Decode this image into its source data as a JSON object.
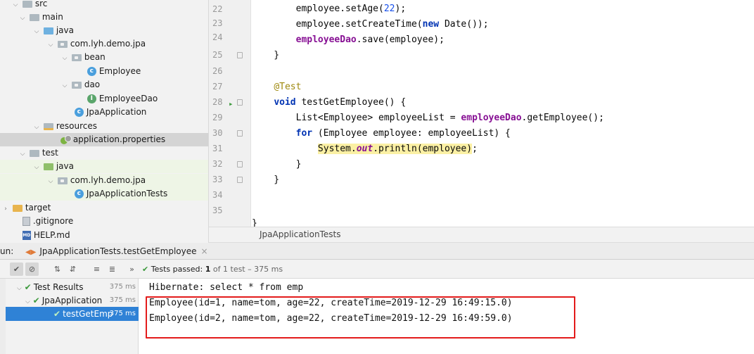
{
  "project_tree": [
    {
      "label": "src",
      "icon": "folder-icon",
      "arrow": "v",
      "indent": 1
    },
    {
      "label": "main",
      "icon": "folder-icon",
      "arrow": "v",
      "indent": 2
    },
    {
      "label": "java",
      "icon": "source-folder-icon",
      "arrow": "v",
      "indent": 3
    },
    {
      "label": "com.lyh.demo.jpa",
      "icon": "package-icon",
      "arrow": "v",
      "indent": 4
    },
    {
      "label": "bean",
      "icon": "package-icon",
      "arrow": "v",
      "indent": 5
    },
    {
      "label": "Employee",
      "icon": "class-icon",
      "arrow": "",
      "indent": 6
    },
    {
      "label": "dao",
      "icon": "package-icon",
      "arrow": "v",
      "indent": 5
    },
    {
      "label": "EmployeeDao",
      "icon": "interface-icon",
      "arrow": "",
      "indent": 6
    },
    {
      "label": "JpaApplication",
      "icon": "spring-class-icon",
      "arrow": "",
      "indent": 5
    },
    {
      "label": "resources",
      "icon": "resources-folder-icon",
      "arrow": "v",
      "indent": 3
    },
    {
      "label": "application.properties",
      "icon": "properties-file-icon",
      "arrow": "",
      "indent": 4
    },
    {
      "label": "test",
      "icon": "folder-icon",
      "arrow": "v",
      "indent": 2
    },
    {
      "label": "java",
      "icon": "test-folder-icon",
      "arrow": "v",
      "indent": 3
    },
    {
      "label": "com.lyh.demo.jpa",
      "icon": "package-icon",
      "arrow": "v",
      "indent": 4
    },
    {
      "label": "JpaApplicationTests",
      "icon": "spring-class-icon",
      "arrow": "",
      "indent": 5
    },
    {
      "label": "target",
      "icon": "excluded-folder-icon",
      "arrow": ">",
      "indent": 1
    },
    {
      "label": ".gitignore",
      "icon": "gitignore-file-icon",
      "arrow": "",
      "indent": 1
    },
    {
      "label": "HELP.md",
      "icon": "markdown-file-icon",
      "arrow": "",
      "indent": 1
    }
  ],
  "gutter": [
    {
      "num": "22"
    },
    {
      "num": "23"
    },
    {
      "num": "24"
    },
    {
      "num": "25"
    },
    {
      "num": "26"
    },
    {
      "num": "27"
    },
    {
      "num": "28"
    },
    {
      "num": "29"
    },
    {
      "num": "30"
    },
    {
      "num": "31"
    },
    {
      "num": "32"
    },
    {
      "num": "33"
    },
    {
      "num": "34"
    },
    {
      "num": "35"
    }
  ],
  "code": {
    "l22_a": "        employee.setAge(",
    "l22_num": "22",
    "l22_b": ");",
    "l23_a": "        employee.setCreateTime(",
    "l23_kw": "new",
    "l23_b": " Date());",
    "l24_fld": "employeeDao",
    "l24_b": ".save(employee);",
    "l25": "    }",
    "l27_ann": "@Test",
    "l28_kw": "void",
    "l28_b": " testGetEmployee() {",
    "l29_a": "        List<Employee> employeeList = ",
    "l29_fld": "employeeDao",
    "l29_b": ".getEmployee();",
    "l30_kw": "for",
    "l30_b": " (Employee employee: employeeList) {",
    "l31_a": "System.",
    "l31_out": "out",
    "l31_b": ".println(employee)",
    "l31_c": ";",
    "l32": "        }",
    "l33": "    }",
    "l36": "}"
  },
  "editor_tab": "JpaApplicationTests",
  "run_panel": {
    "label": "un:",
    "tab": "JpaApplicationTests.testGetEmployee",
    "close": "×",
    "status_prefix": "Tests passed:",
    "status_count": "1",
    "status_rest": "of 1 test – 375 ms"
  },
  "test_tree": [
    {
      "label": "Test Results",
      "duration": "375 ms"
    },
    {
      "label": "JpaApplication",
      "duration": "375 ms"
    },
    {
      "label": "testGetEmp",
      "duration": "375 ms"
    }
  ],
  "console": [
    "Hibernate: select * from emp",
    "Employee(id=1, name=tom, age=22, createTime=2019-12-29 16:49:15.0)",
    "Employee(id=2, name=tom, age=22, createTime=2019-12-29 16:49:59.0)"
  ],
  "colors": {
    "keyword": "#0033b3",
    "field": "#871094",
    "annotation": "#9e880d",
    "highlight": "#fbf0a4",
    "selection": "#2f82d6",
    "pass": "#3d9a3d",
    "highlight_box": "#e31b1b"
  }
}
